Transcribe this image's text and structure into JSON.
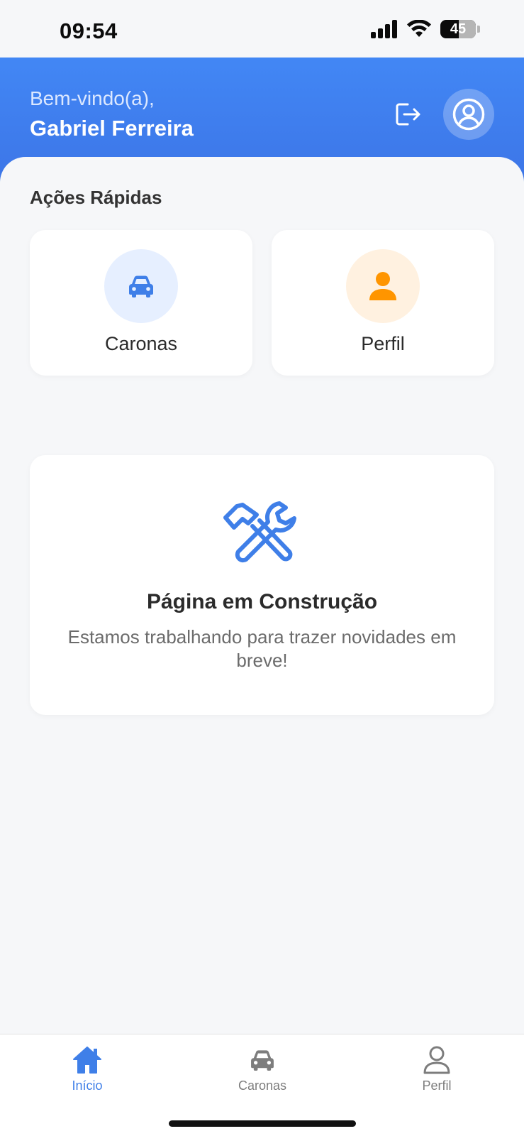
{
  "status_bar": {
    "time": "09:54",
    "battery": "45"
  },
  "header": {
    "welcome": "Bem-vindo(a),",
    "user_name": "Gabriel Ferreira",
    "colors": {
      "gradient_top": "#4287f5",
      "gradient_bottom": "#3c74e6"
    }
  },
  "quick_actions": {
    "title": "Ações Rápidas",
    "items": [
      {
        "label": "Caronas",
        "icon": "car-icon",
        "color": "#3f7fe8"
      },
      {
        "label": "Perfil",
        "icon": "user-icon",
        "color": "#ff9500"
      }
    ]
  },
  "construction": {
    "icon": "tools-icon",
    "title": "Página em Construção",
    "text": "Estamos trabalhando para trazer novidades em breve!"
  },
  "bottom_nav": {
    "items": [
      {
        "label": "Início",
        "icon": "home-icon",
        "active": true
      },
      {
        "label": "Caronas",
        "icon": "car-icon",
        "active": false
      },
      {
        "label": "Perfil",
        "icon": "user-icon",
        "active": false
      }
    ],
    "active_color": "#3f7fe8"
  }
}
